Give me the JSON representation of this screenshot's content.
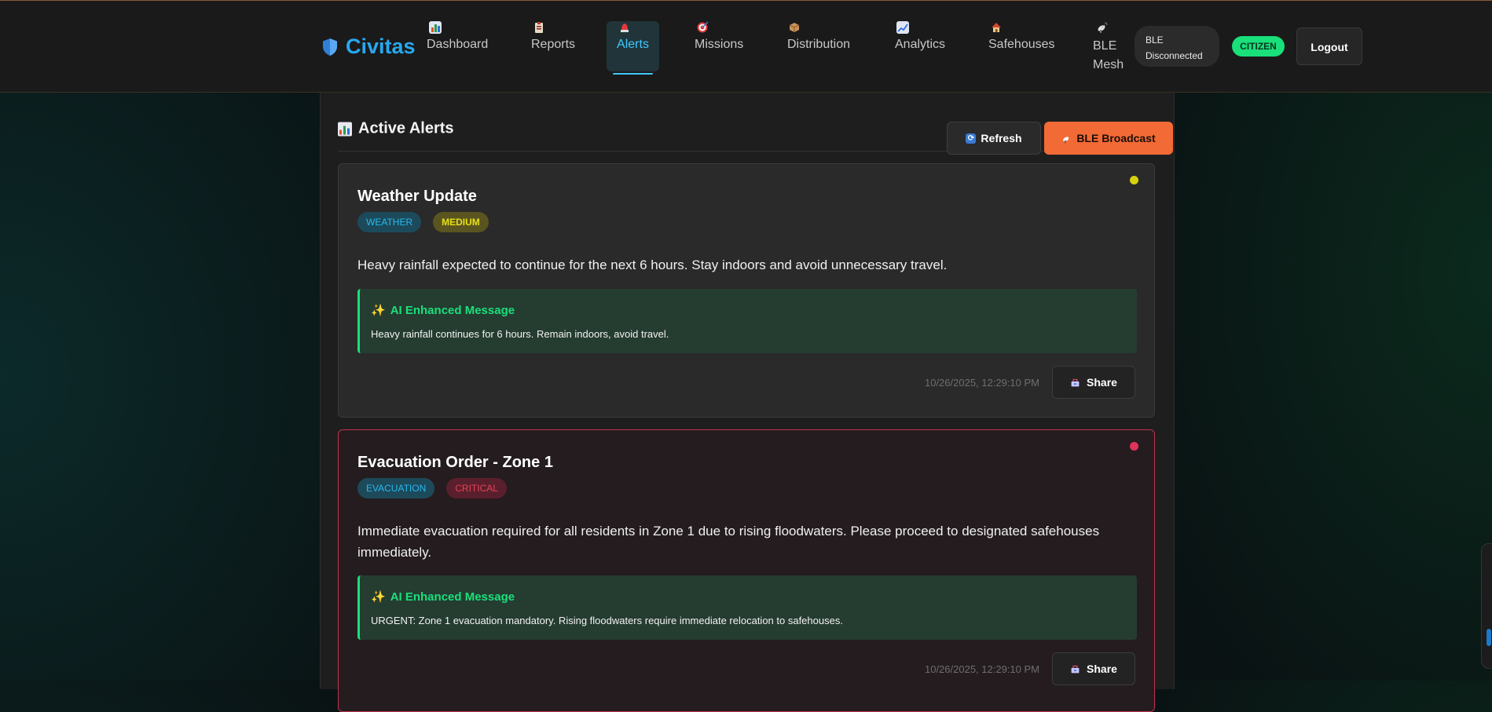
{
  "app": {
    "name": "Civitas"
  },
  "nav": {
    "items": [
      {
        "label": "Dashboard",
        "icon": "bar-chart-icon",
        "active": false
      },
      {
        "label": "Reports",
        "icon": "clipboard-icon",
        "active": false
      },
      {
        "label": "Alerts",
        "icon": "siren-icon",
        "active": true
      },
      {
        "label": "Missions",
        "icon": "target-icon",
        "active": false
      },
      {
        "label": "Distribution",
        "icon": "package-icon",
        "active": false
      },
      {
        "label": "Analytics",
        "icon": "line-chart-icon",
        "active": false
      },
      {
        "label": "Safehouses",
        "icon": "house-icon",
        "active": false
      },
      {
        "label_line1": "BLE",
        "label_line2": "Mesh",
        "icon": "satellite-antenna-icon",
        "active": false
      }
    ]
  },
  "header": {
    "ble_status_line1": "BLE",
    "ble_status_line2": "Disconnected",
    "role": "CITIZEN",
    "logout_label": "Logout"
  },
  "section": {
    "title": "Active Alerts",
    "refresh_label": "Refresh",
    "broadcast_label": "BLE Broadcast"
  },
  "alerts": [
    {
      "title": "Weather Update",
      "type": "WEATHER",
      "severity": "MEDIUM",
      "severity_color": "#d6d10f",
      "message": "Heavy rainfall expected to continue for the next 6 hours. Stay indoors and avoid unnecessary travel.",
      "ai_label": "AI Enhanced Message",
      "ai_message": "Heavy rainfall continues for 6 hours. Remain indoors, avoid travel.",
      "timestamp": "10/26/2025, 12:29:10 PM",
      "share_label": "Share"
    },
    {
      "title": "Evacuation Order - Zone 1",
      "type": "EVACUATION",
      "severity": "CRITICAL",
      "severity_color": "#e0345a",
      "message": "Immediate evacuation required for all residents in Zone 1 due to rising floodwaters. Please proceed to designated safehouses immediately.",
      "ai_label": "AI Enhanced Message",
      "ai_message": "URGENT: Zone 1 evacuation mandatory. Rising floodwaters require immediate relocation to safehouses.",
      "timestamp": "10/26/2025, 12:29:10 PM",
      "share_label": "Share"
    }
  ]
}
